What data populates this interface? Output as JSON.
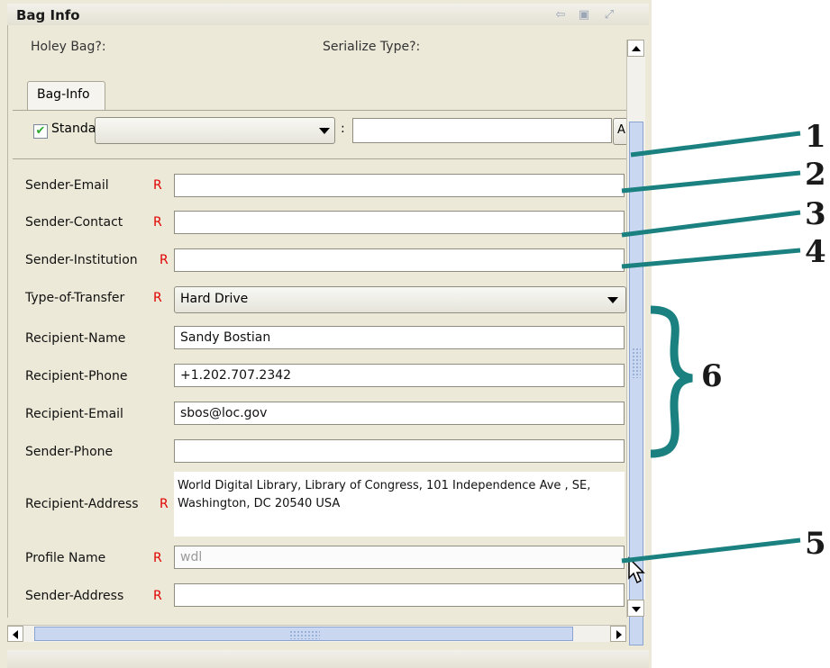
{
  "panel": {
    "title": "Bag Info"
  },
  "header_fields": {
    "holey_bag": "Holey Bag?:",
    "serialize_type": "Serialize Type?:"
  },
  "tab": {
    "label": "Bag-Info"
  },
  "standard": {
    "label": "Standard",
    "checked": true,
    "colon": ":",
    "btn_text": "A"
  },
  "required_marker": "R",
  "fields": [
    {
      "label": "Sender-Email",
      "required": true,
      "value": ""
    },
    {
      "label": "Sender-Contact",
      "required": true,
      "value": ""
    },
    {
      "label": "Sender-Institution",
      "required": true,
      "value": ""
    },
    {
      "label": "Type-of-Transfer",
      "required": true,
      "value": "Hard Drive"
    },
    {
      "label": "Recipient-Name",
      "required": false,
      "value": "Sandy Bostian"
    },
    {
      "label": "Recipient-Phone",
      "required": false,
      "value": "+1.202.707.2342"
    },
    {
      "label": "Recipient-Email",
      "required": false,
      "value": "sbos@loc.gov"
    },
    {
      "label": "Sender-Phone",
      "required": false,
      "value": ""
    },
    {
      "label": "Recipient-Address",
      "required": true,
      "value": "World Digital Library, Library of Congress, 101 Independence Ave , SE, Washington, DC 20540 USA"
    },
    {
      "label": "Profile Name",
      "required": true,
      "value": "wdl"
    },
    {
      "label": "Sender-Address",
      "required": true,
      "value": ""
    }
  ],
  "callouts": {
    "c1": "1",
    "c2": "2",
    "c3": "3",
    "c4": "4",
    "c5": "5",
    "c6": "6"
  },
  "colors": {
    "callout_line": "#1a8080",
    "required": "#e00000",
    "scroll_thumb": "#c9d8f0"
  }
}
